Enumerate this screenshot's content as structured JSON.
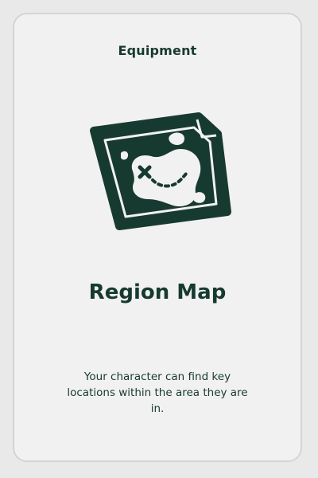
{
  "card": {
    "category": "Equipment",
    "title": "Region Map",
    "description": "Your character can find key locations within the area they are in.",
    "art_icon": "treasure-map-icon"
  },
  "colors": {
    "ink": "#173a30",
    "card_background": "#f1f1f1",
    "page_background": "#e9e9e9"
  }
}
